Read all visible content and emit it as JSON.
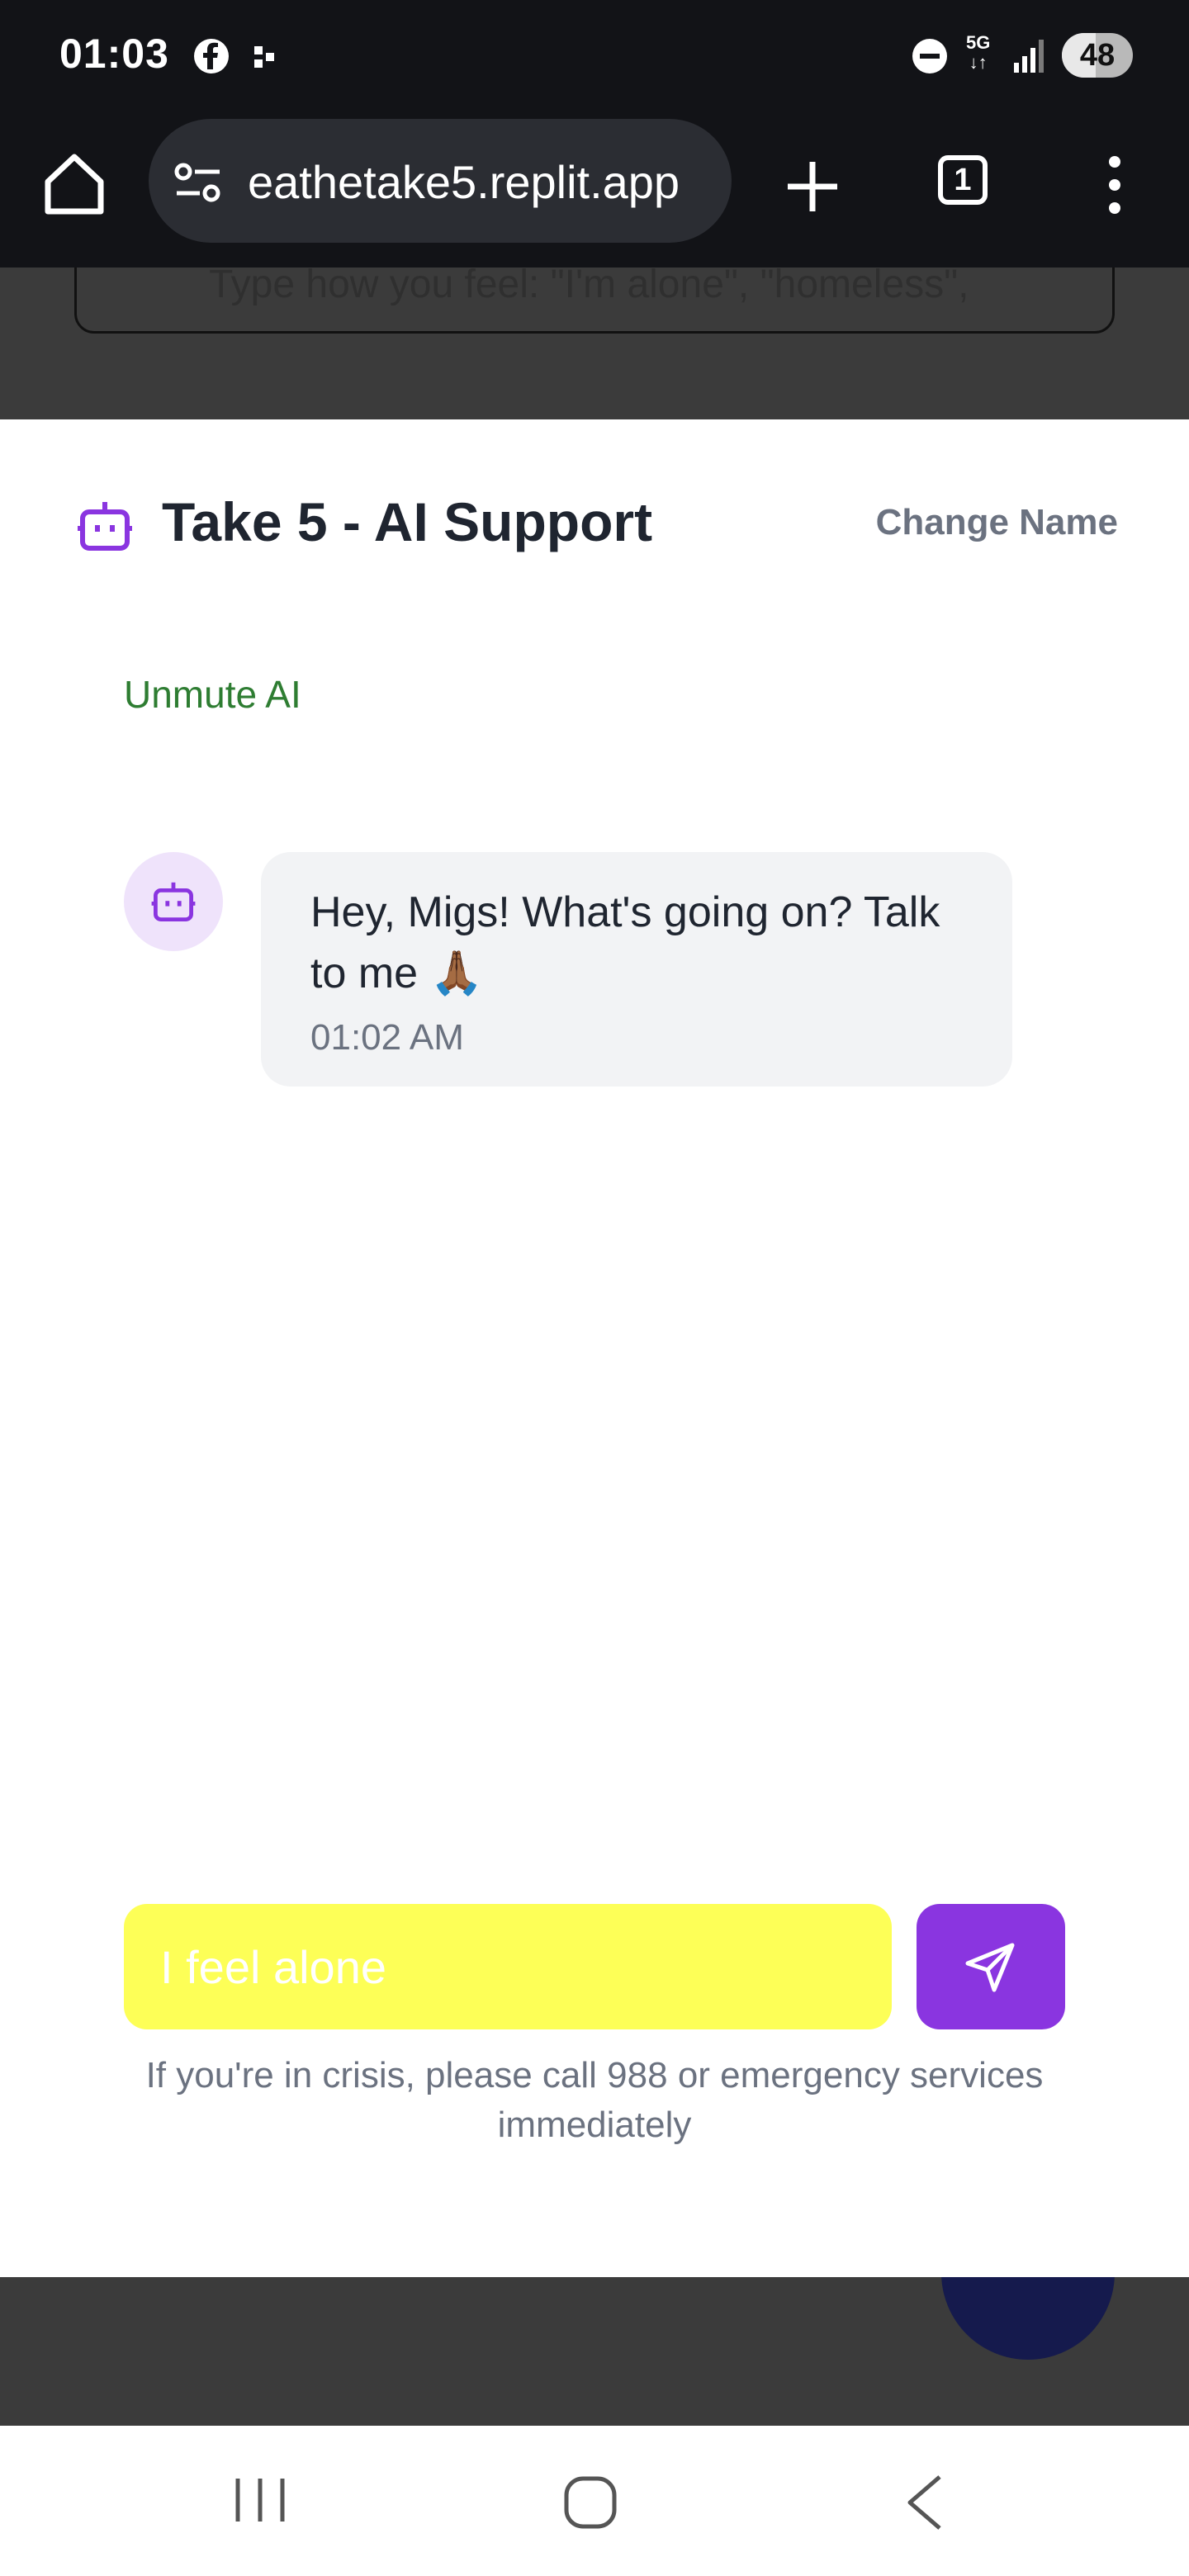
{
  "status_bar": {
    "time": "01:03",
    "network_top": "5G",
    "network_bottom": "↓↑",
    "battery_percent": "48",
    "battery_level": 0.48,
    "icons": [
      "facebook-icon",
      "notification-dots-icon",
      "do-not-disturb-icon",
      "signal-icon",
      "battery-icon"
    ]
  },
  "browser": {
    "url": "eathetake5.replit.app",
    "tab_count": "1",
    "icons": [
      "home-icon",
      "site-settings-icon",
      "new-tab-plus-icon",
      "tab-switcher-icon",
      "overflow-menu-icon"
    ]
  },
  "background_page": {
    "search_placeholder": "Type how you feel: \"I'm alone\", \"homeless\","
  },
  "chat": {
    "title": "Take 5 - AI Support",
    "change_name_label": "Change Name",
    "unmute_label": "Unmute AI",
    "messages": [
      {
        "sender": "ai",
        "text": "Hey, Migs! What's going on? Talk to me 🙏🏾",
        "time": "01:02 AM"
      }
    ],
    "input_placeholder": "I feel alone",
    "send_icon": "send-icon",
    "crisis_notice": "If you're in crisis, please call 988 or emergency services immediately"
  },
  "colors": {
    "accent": "#8a35e0",
    "input_bg": "#fdff57",
    "unmute": "#2e7d32",
    "bubble": "#f2f3f5"
  },
  "nav_bar": {
    "icons": [
      "recent-apps-icon",
      "home-nav-icon",
      "back-icon"
    ]
  }
}
